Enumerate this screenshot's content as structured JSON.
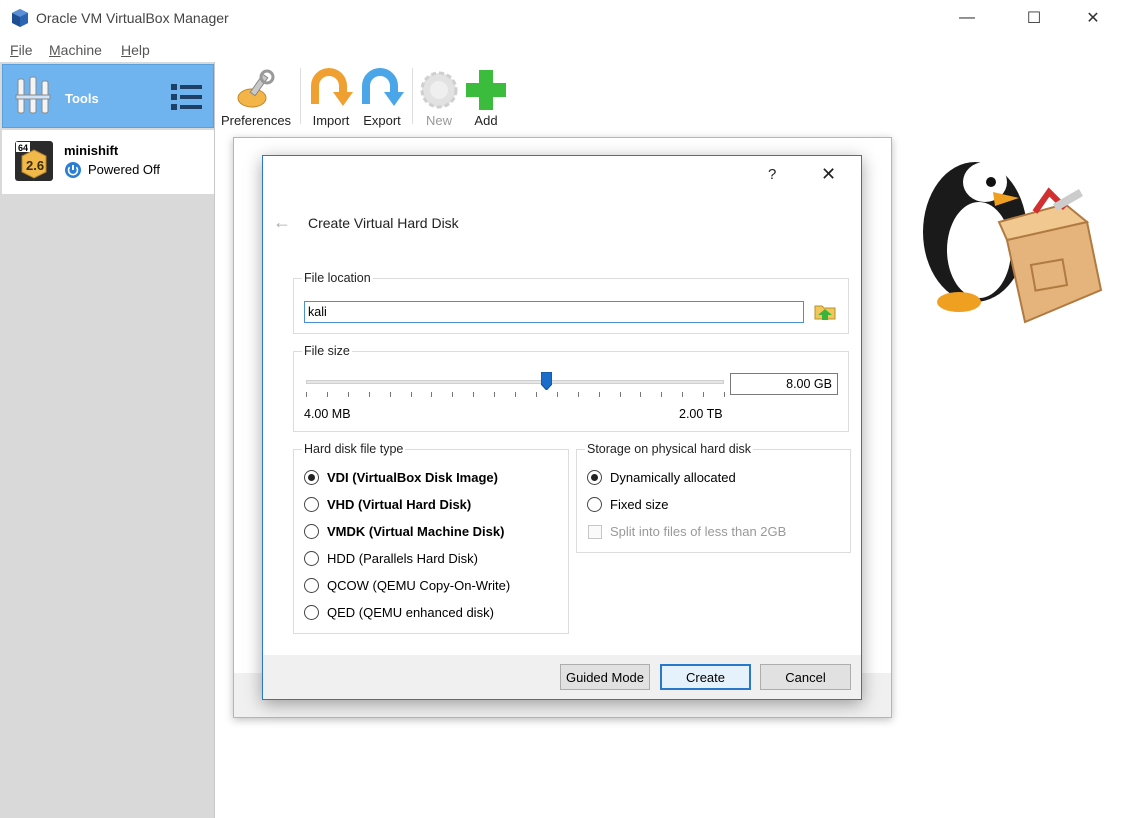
{
  "window": {
    "title": "Oracle VM VirtualBox Manager",
    "controls": {
      "minimize": "—",
      "maximize": "☐",
      "close": "✕"
    }
  },
  "menu": [
    {
      "label": "File",
      "mnemonic": "F",
      "rest": "ile"
    },
    {
      "label": "Machine",
      "mnemonic": "M",
      "rest": "achine"
    },
    {
      "label": "Help",
      "mnemonic": "H",
      "rest": "elp"
    }
  ],
  "sidebar": {
    "tools_label": "Tools",
    "vm": {
      "name": "minishift",
      "state": "Powered Off",
      "badge_arch": "64",
      "badge_version": "2.6"
    }
  },
  "toolbar": {
    "preferences": "Preferences",
    "import": "Import",
    "export": "Export",
    "new": "New",
    "add": "Add"
  },
  "dialog": {
    "title": "Create Virtual Hard Disk",
    "help": "?",
    "close": "✕",
    "back": "←",
    "file_location": {
      "label": "File location",
      "value": "kali"
    },
    "file_size": {
      "label": "File size",
      "value": "8.00 GB",
      "min_label": "4.00 MB",
      "max_label": "2.00 TB",
      "slider_fraction": 0.575
    },
    "disk_type": {
      "label": "Hard disk file type",
      "options": [
        {
          "label": "VDI (VirtualBox Disk Image)",
          "bold": true,
          "selected": true
        },
        {
          "label": "VHD (Virtual Hard Disk)",
          "bold": true,
          "selected": false
        },
        {
          "label": "VMDK (Virtual Machine Disk)",
          "bold": true,
          "selected": false
        },
        {
          "label": "HDD (Parallels Hard Disk)",
          "bold": false,
          "selected": false
        },
        {
          "label": "QCOW (QEMU Copy-On-Write)",
          "bold": false,
          "selected": false
        },
        {
          "label": "QED (QEMU enhanced disk)",
          "bold": false,
          "selected": false
        }
      ]
    },
    "storage": {
      "label": "Storage on physical hard disk",
      "dynamic": "Dynamically allocated",
      "fixed": "Fixed size",
      "split": "Split into files of less than 2GB",
      "selected": "dynamic"
    },
    "buttons": {
      "guided": "Guided Mode",
      "create": "Create",
      "cancel": "Cancel"
    }
  }
}
